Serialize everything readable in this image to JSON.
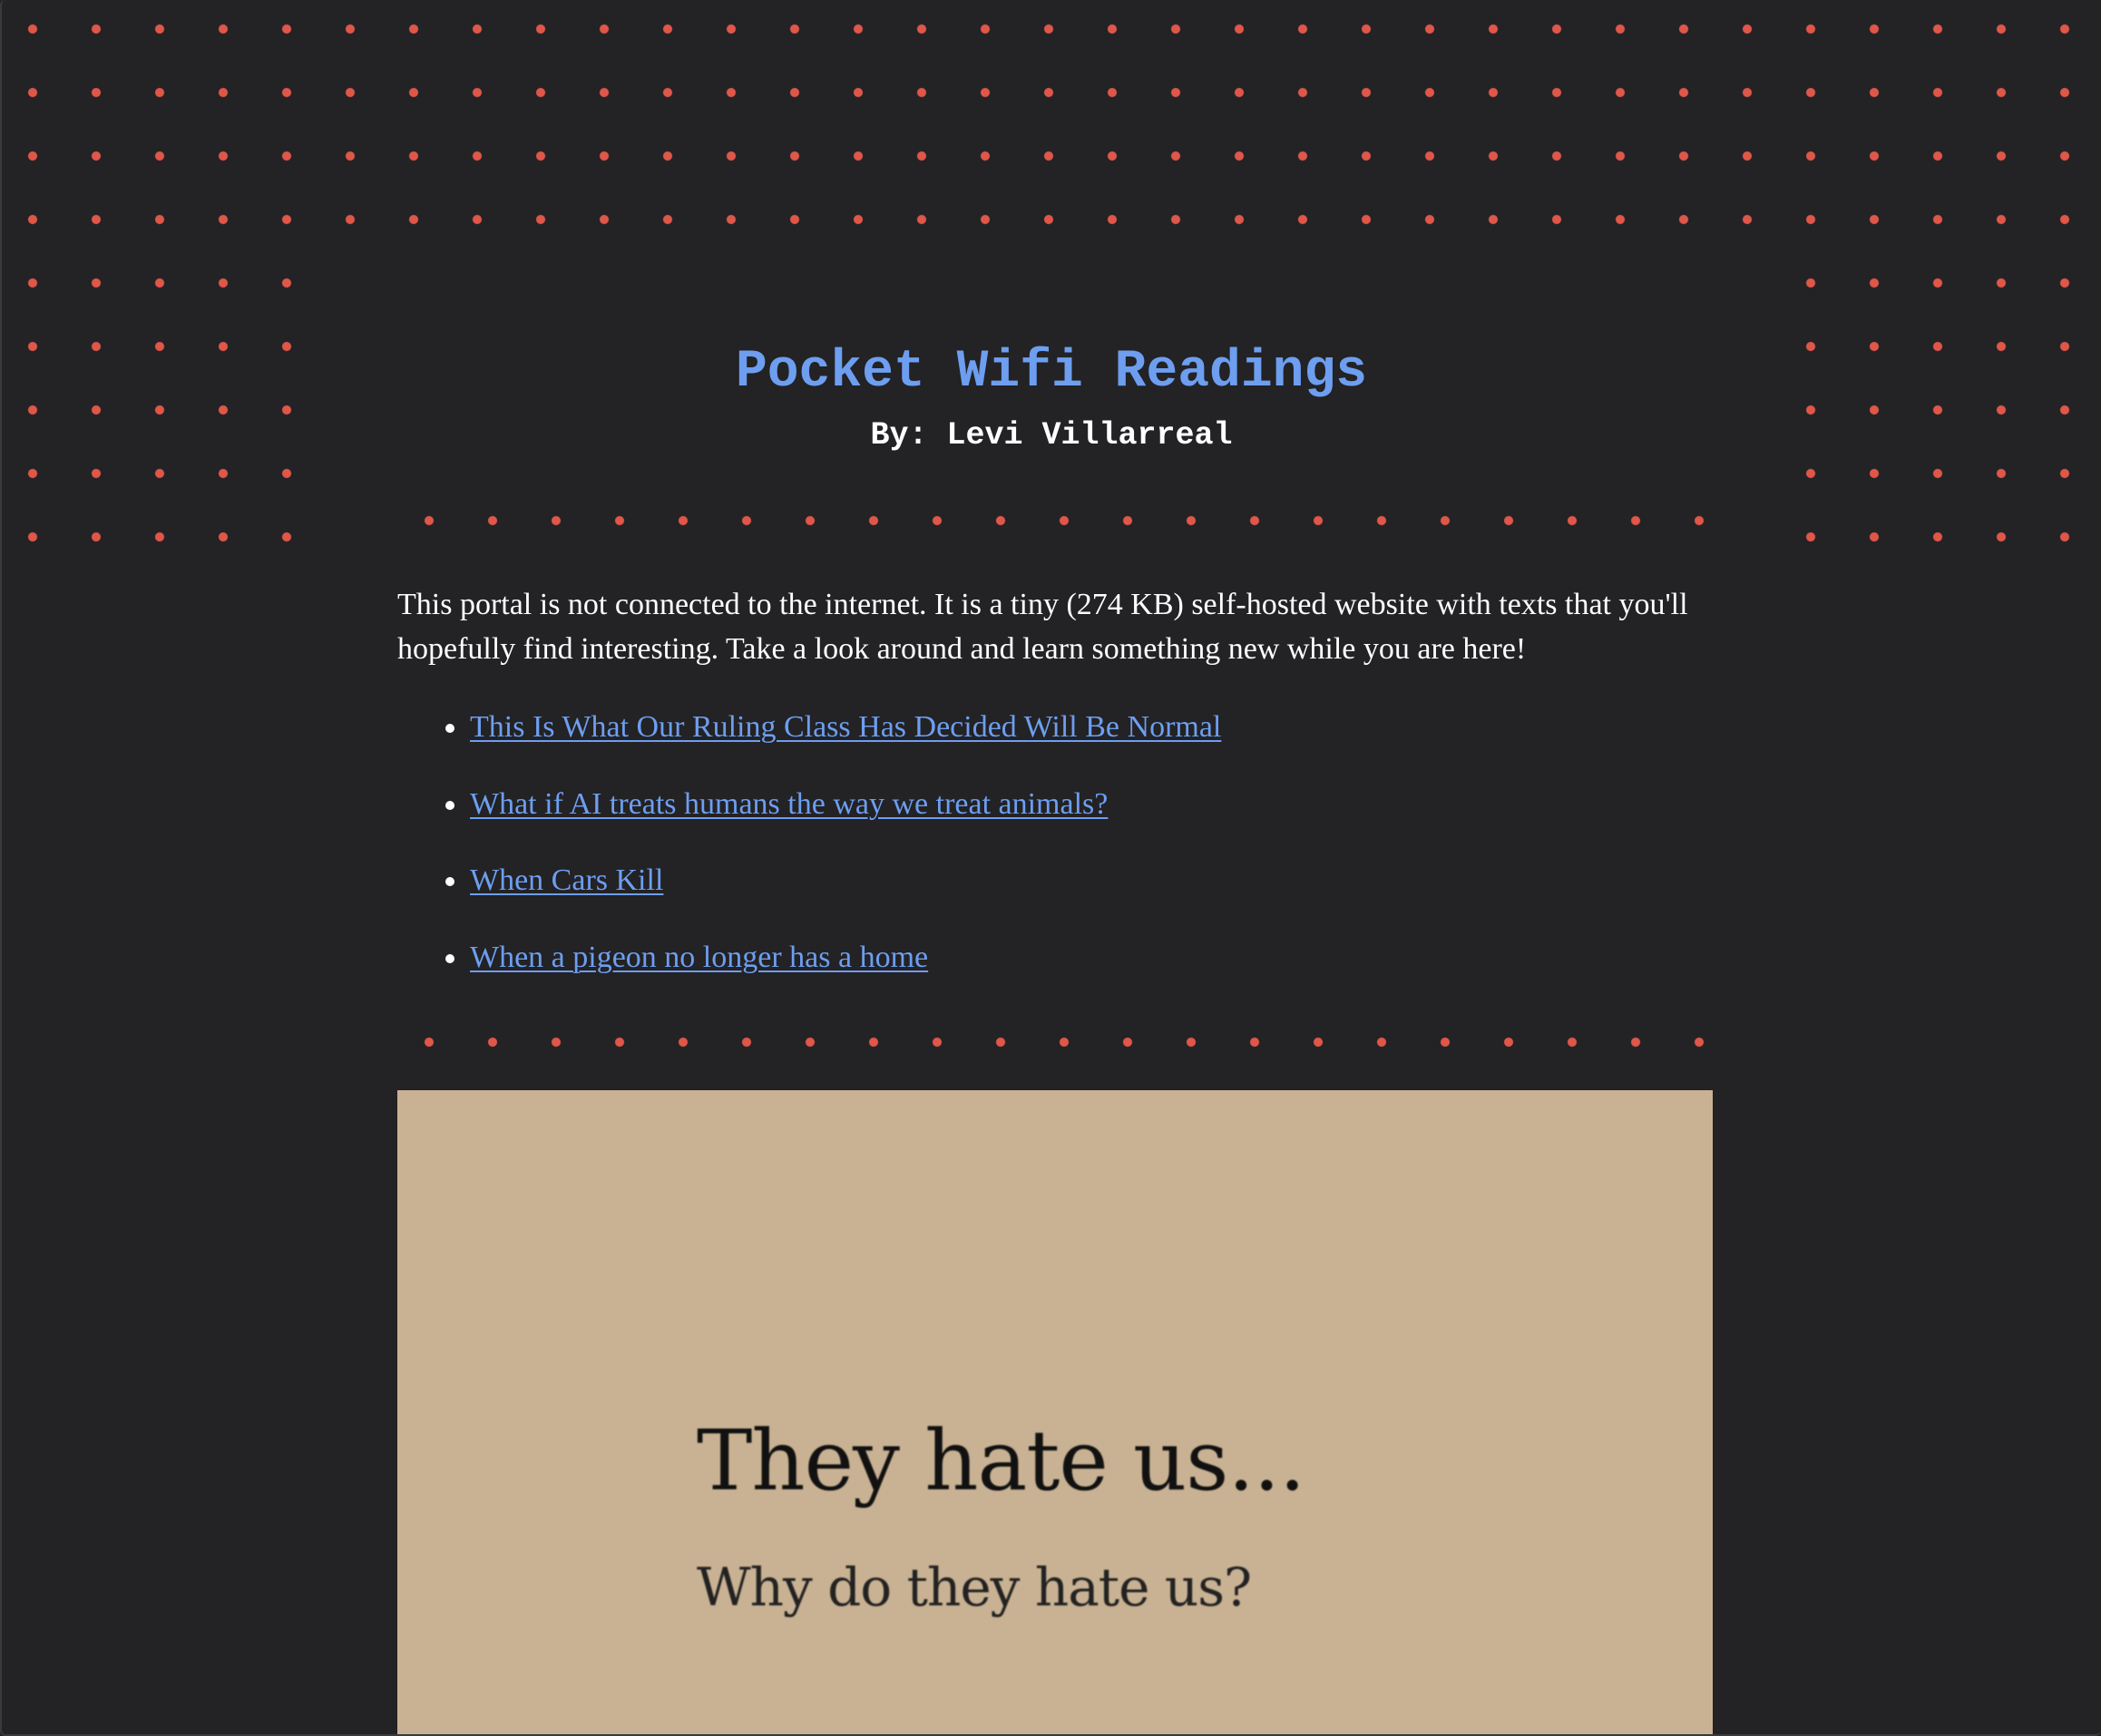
{
  "header": {
    "title": "Pocket Wifi Readings",
    "byline": "By: Levi Villarreal"
  },
  "intro": {
    "text": "This portal is not connected to the internet. It is a tiny (274 KB) self-hosted website with texts that you'll hopefully find interesting. Take a look around and learn something new while you are here!"
  },
  "articles": [
    {
      "label": "This Is What Our Ruling Class Has Decided Will Be Normal"
    },
    {
      "label": "What if AI treats humans the way we treat animals?"
    },
    {
      "label": "When Cars Kill"
    },
    {
      "label": "When a pigeon no longer has a home"
    }
  ],
  "feature": {
    "headline": "They hate us...",
    "subheadline": "Why do they hate us?"
  },
  "colors": {
    "background": "#232224",
    "accent_dots": "#e0574a",
    "link": "#6d9ef0",
    "feature_bg": "#c9b293"
  }
}
